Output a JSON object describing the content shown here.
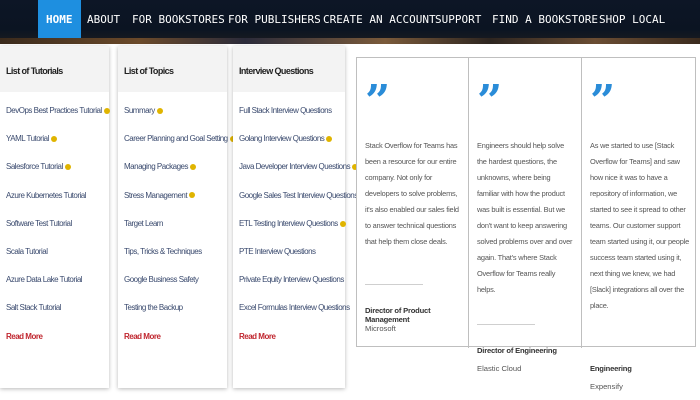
{
  "nav": {
    "items": [
      "HOME",
      "ABOUT",
      "FOR BOOKSTORES",
      "FOR PUBLISHERS",
      "CREATE AN ACCOUNT",
      "SUPPORT",
      "FIND A BOOKSTORE",
      "SHOP LOCAL"
    ],
    "active": "HOME"
  },
  "menus": [
    {
      "title": "List of Tutorials",
      "items": [
        {
          "label": "DevOps Best Practices Tutorial",
          "badge": true
        },
        {
          "label": "YAML Tutorial",
          "badge": true
        },
        {
          "label": "Salesforce Tutorial",
          "badge": true
        },
        {
          "label": "Azure Kubernetes Tutorial",
          "badge": false
        },
        {
          "label": "Software Test Tutorial",
          "badge": false
        },
        {
          "label": "Scala Tutorial",
          "badge": false
        },
        {
          "label": "Azure Data Lake Tutorial",
          "badge": false
        },
        {
          "label": "Salt Stack Tutorial",
          "badge": false
        }
      ],
      "more": "Read More"
    },
    {
      "title": "List of Topics",
      "items": [
        {
          "label": "Summary",
          "badge": true
        },
        {
          "label": "Career Planning and Goal Setting",
          "badge": true
        },
        {
          "label": "Managing Packages",
          "badge": true
        },
        {
          "label": "Stress Management",
          "badge": true
        },
        {
          "label": "Target Learn",
          "badge": false
        },
        {
          "label": "Tips, Tricks & Techniques",
          "badge": false
        },
        {
          "label": "Google Business Safety",
          "badge": false
        },
        {
          "label": "Testing the Backup",
          "badge": false
        }
      ],
      "more": "Read More"
    },
    {
      "title": "Interview Questions",
      "items": [
        {
          "label": "Full Stack Interview Questions",
          "badge": false
        },
        {
          "label": "Golang Interview Questions",
          "badge": true
        },
        {
          "label": "Java Developer Interview Questions",
          "badge": true
        },
        {
          "label": "Google Sales Test Interview Questions",
          "badge": true
        },
        {
          "label": "ETL Testing Interview Questions",
          "badge": true
        },
        {
          "label": "PTE Interview Questions",
          "badge": false
        },
        {
          "label": "Private Equity Interview Questions",
          "badge": false
        },
        {
          "label": "Excel Formulas Interview Questions",
          "badge": false
        }
      ],
      "more": "Read More"
    }
  ],
  "testimonials": [
    {
      "quote": "Stack Overflow for Teams has been a resource for our entire company. Not only for developers to solve problems, it's also enabled our sales field to answer technical questions that help them close deals.",
      "role": "Director of Product Management",
      "company": "Microsoft"
    },
    {
      "quote": "Engineers should help solve the hardest questions, the unknowns, where being familiar with how the product was built is essential. But we don't want to keep answering solved problems over and over again. That's where Stack Overflow for Teams really helps.",
      "role": "Director of Engineering",
      "company": "Elastic Cloud"
    },
    {
      "quote": "As we started to use [Stack Overflow for Teams] and saw how nice it was to have a repository of information, we started to see it spread to other teams. Our customer support team started using it, our people success team started using it, next thing we knew, we had [Slack] integrations all over the place.",
      "role": "Engineering",
      "company": "Expensify"
    }
  ],
  "colors": {
    "nav_bg": "#0b1422",
    "nav_active": "#1e8fe0",
    "quote_accent": "#2a8cd8",
    "read_more": "#c0262f",
    "badge": "#e0b400"
  }
}
